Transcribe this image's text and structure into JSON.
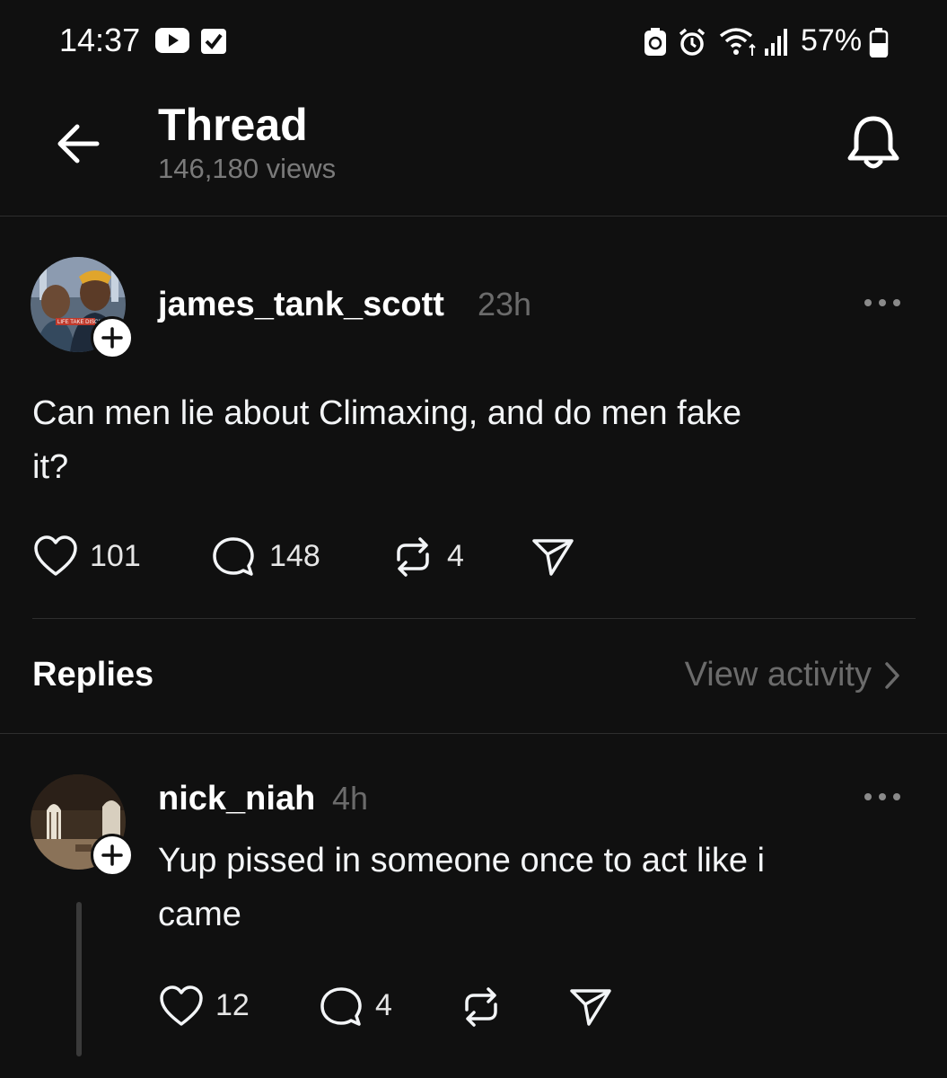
{
  "status_bar": {
    "time": "14:37",
    "battery_percent": "57%",
    "icons": [
      "youtube-icon",
      "check-box-icon",
      "battery-saver-icon",
      "alarm-icon",
      "wifi-icon",
      "signal-icon",
      "battery-icon"
    ]
  },
  "header": {
    "title": "Thread",
    "views": "146,180 views",
    "icons": [
      "back-arrow-icon",
      "bell-icon"
    ]
  },
  "post": {
    "username": "james_tank_scott",
    "time": "23h",
    "text_line1": "Can men lie about Climaxing, and do men fake",
    "text_line2": "it?",
    "likes": "101",
    "comments": "148",
    "reposts": "4",
    "avatar_caption": "LIFE TAKE DISCIPLINE"
  },
  "replies_section": {
    "title": "Replies",
    "view_activity": "View activity"
  },
  "reply": {
    "username": "nick_niah",
    "time": "4h",
    "text_line1": "Yup pissed in someone once to act like i",
    "text_line2": "came",
    "likes": "12",
    "comments": "4"
  },
  "colors": {
    "background": "#101010",
    "text": "#f3f5f7",
    "muted": "#6b6b6b",
    "divider": "#2e2e2e"
  }
}
